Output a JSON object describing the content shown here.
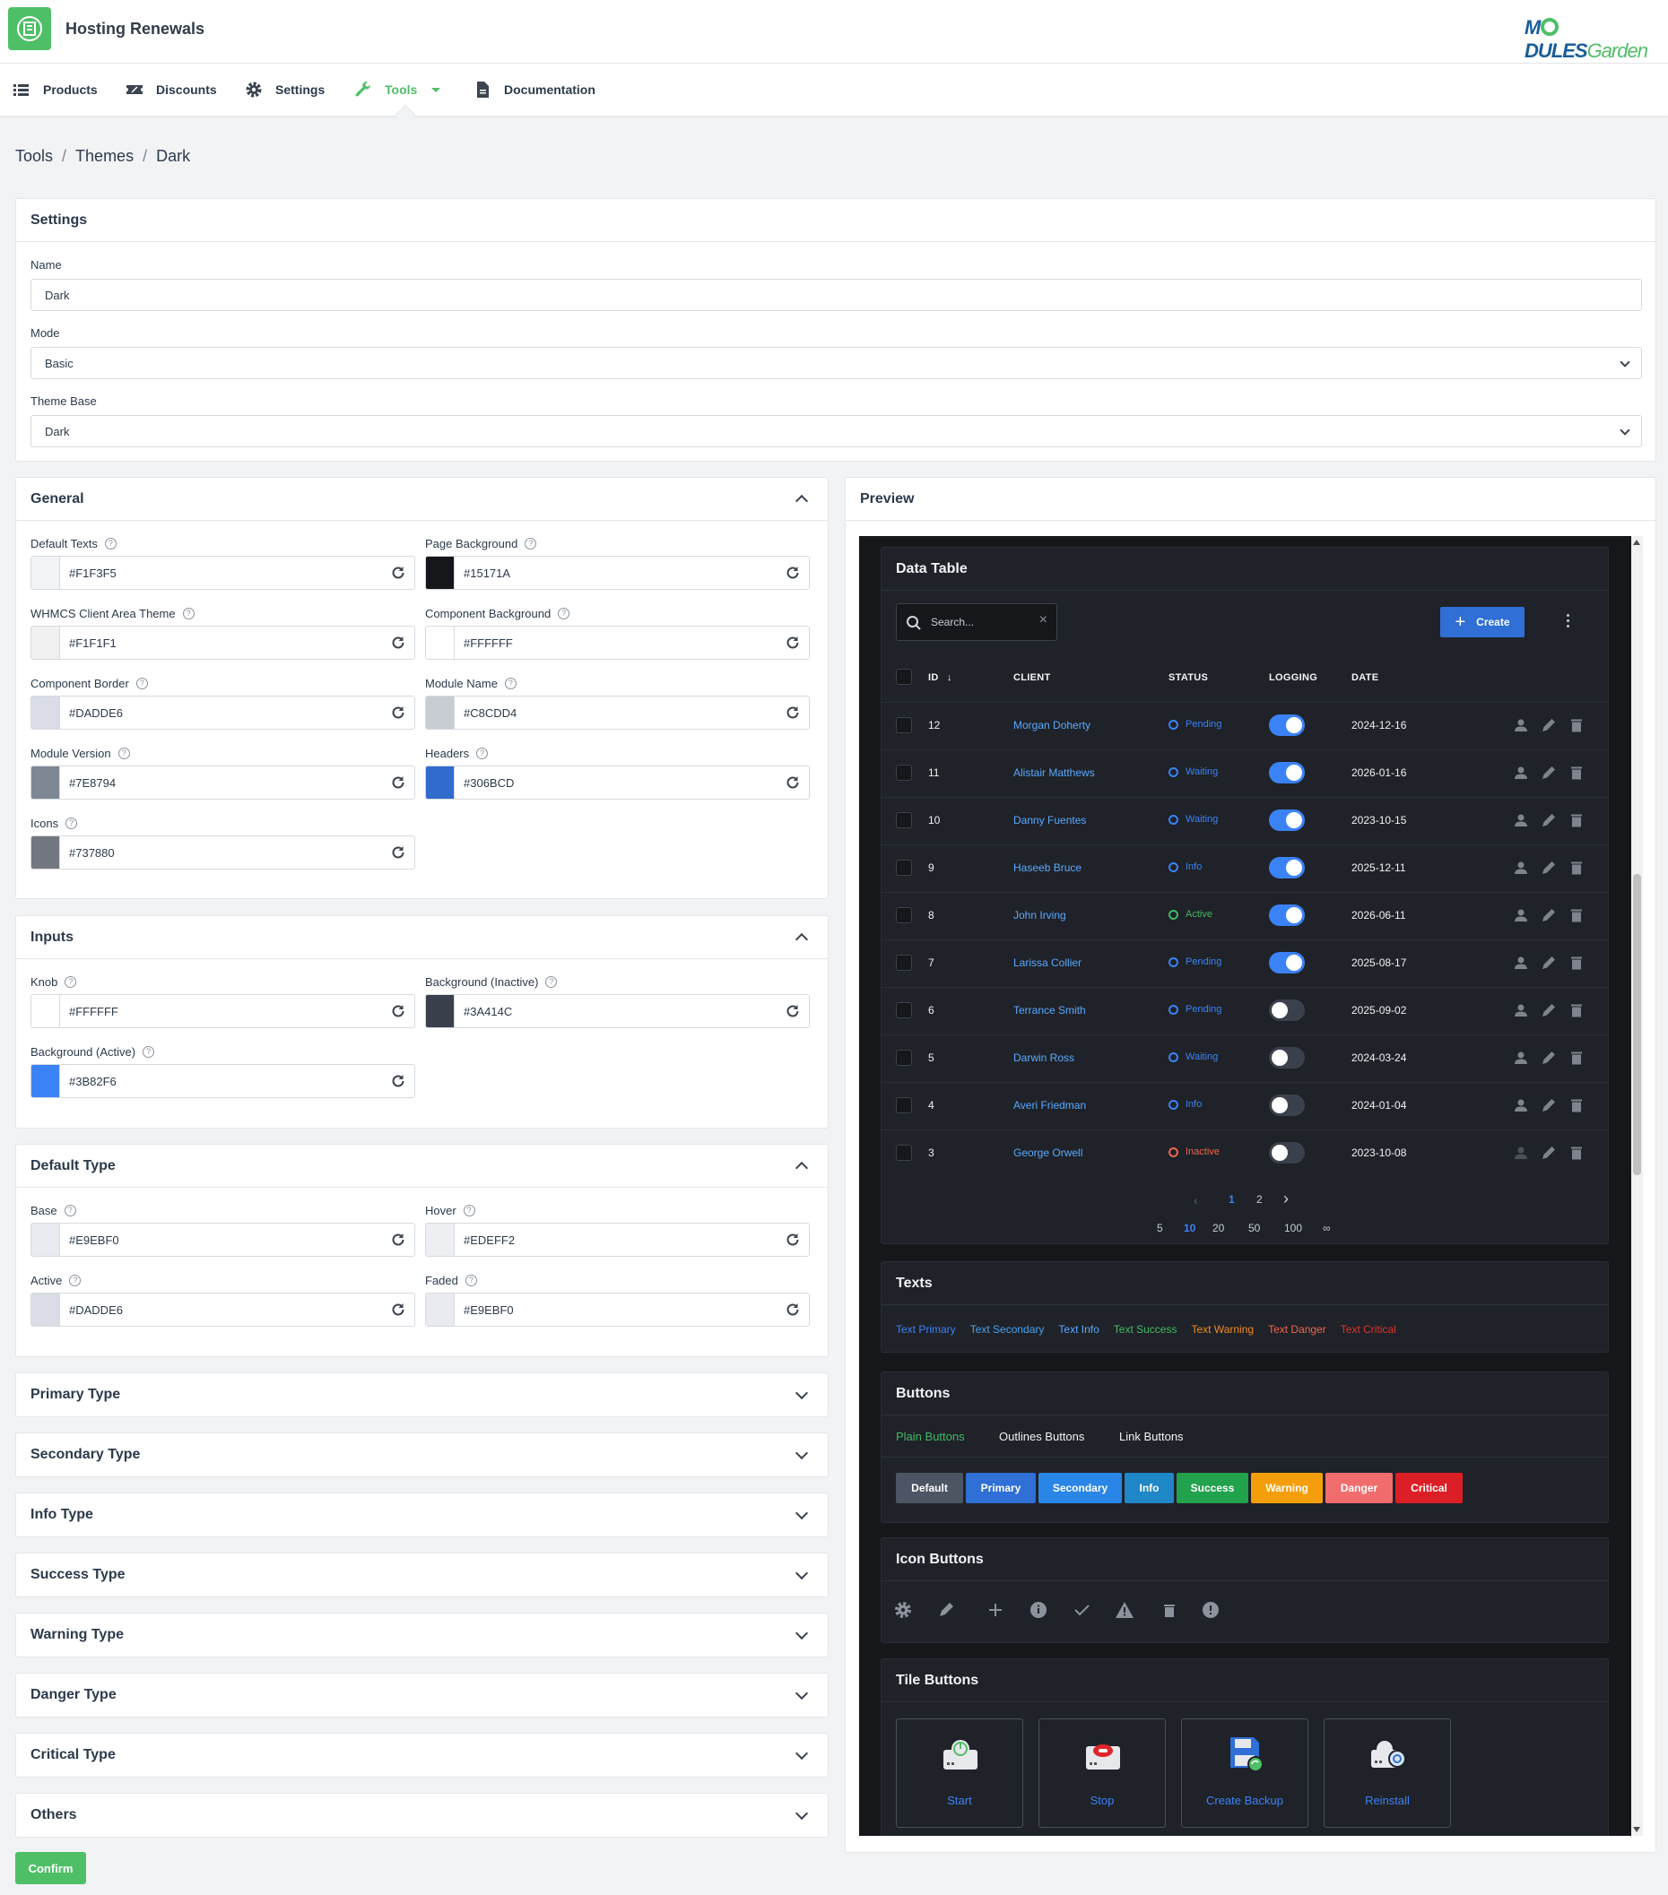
{
  "app": {
    "title": "Hosting Renewals",
    "brand_a": "M",
    "brand_b": "DULES",
    "brand_c": "Garden"
  },
  "nav": {
    "items": [
      {
        "label": "Products",
        "icon": "list-icon"
      },
      {
        "label": "Discounts",
        "icon": "ticket-icon"
      },
      {
        "label": "Settings",
        "icon": "gear-icon"
      },
      {
        "label": "Tools",
        "icon": "wrench-icon",
        "active": true
      },
      {
        "label": "Documentation",
        "icon": "document-icon"
      }
    ]
  },
  "breadcrumb": [
    "Tools",
    "Themes",
    "Dark"
  ],
  "settings": {
    "title": "Settings",
    "name_label": "Name",
    "name_value": "Dark",
    "mode_label": "Mode",
    "mode_value": "Basic",
    "base_label": "Theme Base",
    "base_value": "Dark"
  },
  "general": {
    "title": "General",
    "fields": [
      {
        "label": "Default Texts",
        "value": "#F1F3F5",
        "color": "#F1F3F5"
      },
      {
        "label": "Page Background",
        "value": "#15171A",
        "color": "#15171A"
      },
      {
        "label": "WHMCS Client Area Theme",
        "value": "#F1F1F1",
        "color": "#F1F1F1"
      },
      {
        "label": "Component Background",
        "value": "#FFFFFF",
        "color": "#FFFFFF"
      },
      {
        "label": "Component Border",
        "value": "#DADDE6",
        "color": "#DADDE6"
      },
      {
        "label": "Module Name",
        "value": "#C8CDD4",
        "color": "#C8CDD4"
      },
      {
        "label": "Module Version",
        "value": "#7E8794",
        "color": "#7E8794"
      },
      {
        "label": "Headers",
        "value": "#306BCD",
        "color": "#306BCD"
      },
      {
        "label": "Icons",
        "value": "#737880",
        "color": "#737880"
      }
    ]
  },
  "inputs": {
    "title": "Inputs",
    "fields": [
      {
        "label": "Knob",
        "value": "#FFFFFF",
        "color": "#FFFFFF"
      },
      {
        "label": "Background (Inactive)",
        "value": "#3A414C",
        "color": "#3A414C"
      },
      {
        "label": "Background (Active)",
        "value": "#3B82F6",
        "color": "#3B82F6"
      }
    ]
  },
  "default_type": {
    "title": "Default Type",
    "fields": [
      {
        "label": "Base",
        "value": "#E9EBF0",
        "color": "#E9EBF0"
      },
      {
        "label": "Hover",
        "value": "#EDEFF2",
        "color": "#EDEFF2"
      },
      {
        "label": "Active",
        "value": "#DADDE6",
        "color": "#DADDE6"
      },
      {
        "label": "Faded",
        "value": "#E9EBF0",
        "color": "#E9EBF0"
      }
    ]
  },
  "collapsed": [
    "Primary Type",
    "Secondary Type",
    "Info Type",
    "Success Type",
    "Warning Type",
    "Danger Type",
    "Critical Type",
    "Others"
  ],
  "confirm_label": "Confirm",
  "preview": {
    "title": "Preview",
    "table": {
      "title": "Data Table",
      "search_placeholder": "Search...",
      "create_label": "Create",
      "columns": [
        "ID",
        "CLIENT",
        "STATUS",
        "LOGGING",
        "DATE"
      ],
      "rows": [
        {
          "id": "12",
          "client": "Morgan Doherty",
          "status": "Pending",
          "logging": true,
          "date": "2024-12-16"
        },
        {
          "id": "11",
          "client": "Alistair Matthews",
          "status": "Waiting",
          "logging": true,
          "date": "2026-01-16"
        },
        {
          "id": "10",
          "client": "Danny Fuentes",
          "status": "Waiting",
          "logging": true,
          "date": "2023-10-15"
        },
        {
          "id": "9",
          "client": "Haseeb Bruce",
          "status": "Info",
          "logging": true,
          "date": "2025-12-11"
        },
        {
          "id": "8",
          "client": "John Irving",
          "status": "Active",
          "logging": true,
          "date": "2026-06-11"
        },
        {
          "id": "7",
          "client": "Larissa Collier",
          "status": "Pending",
          "logging": true,
          "date": "2025-08-17"
        },
        {
          "id": "6",
          "client": "Terrance Smith",
          "status": "Pending",
          "logging": false,
          "date": "2025-09-02"
        },
        {
          "id": "5",
          "client": "Darwin Ross",
          "status": "Waiting",
          "logging": false,
          "date": "2024-03-24"
        },
        {
          "id": "4",
          "client": "Averi Friedman",
          "status": "Info",
          "logging": false,
          "date": "2024-01-04"
        },
        {
          "id": "3",
          "client": "George Orwell",
          "status": "Inactive",
          "logging": false,
          "date": "2023-10-08"
        }
      ],
      "pages": [
        "1",
        "2"
      ],
      "page_sizes": [
        "5",
        "10",
        "20",
        "50",
        "100",
        "∞"
      ]
    },
    "texts": {
      "title": "Texts",
      "items": [
        {
          "label": "Text Primary",
          "color": "#3b82f6"
        },
        {
          "label": "Text Secondary",
          "color": "#4aa3f0"
        },
        {
          "label": "Text Info",
          "color": "#5aa9ff"
        },
        {
          "label": "Text Success",
          "color": "#43b864"
        },
        {
          "label": "Text Warning",
          "color": "#f08a24"
        },
        {
          "label": "Text Danger",
          "color": "#f0654d"
        },
        {
          "label": "Text Critical",
          "color": "#d9342b"
        }
      ]
    },
    "buttons": {
      "title": "Buttons",
      "tabs": [
        "Plain Buttons",
        "Outlines Buttons",
        "Link Buttons"
      ],
      "items": [
        {
          "label": "Default",
          "color": "#4b5563"
        },
        {
          "label": "Primary",
          "color": "#2f6fd6"
        },
        {
          "label": "Secondary",
          "color": "#2a86e6"
        },
        {
          "label": "Info",
          "color": "#1f86c7"
        },
        {
          "label": "Success",
          "color": "#23a24d"
        },
        {
          "label": "Warning",
          "color": "#f59e0b"
        },
        {
          "label": "Danger",
          "color": "#f16d6d"
        },
        {
          "label": "Critical",
          "color": "#dc1f26"
        }
      ]
    },
    "icon_buttons": {
      "title": "Icon Buttons",
      "icons": [
        "gear-icon",
        "pencil-icon",
        "plus-icon",
        "info-icon",
        "check-icon",
        "warning-icon",
        "trash-icon",
        "alert-icon"
      ]
    },
    "tile_buttons": {
      "title": "Tile Buttons",
      "items": [
        "Start",
        "Stop",
        "Create Backup",
        "Reinstall"
      ]
    }
  }
}
